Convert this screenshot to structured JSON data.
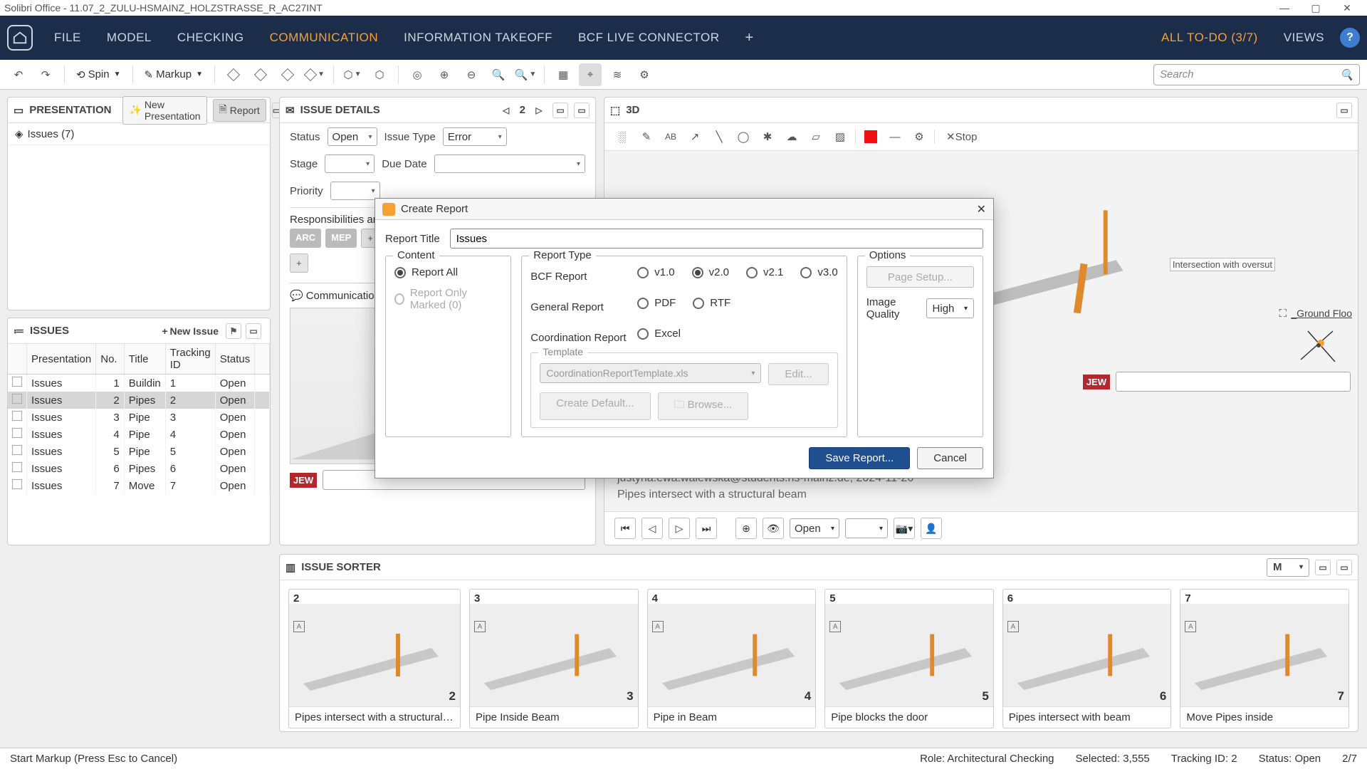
{
  "window": {
    "title": "Solibri Office - 11.07_2_ZULU-HSMAINZ_HOLZSTRASSE_R_AC27INT"
  },
  "nav": {
    "items": [
      "FILE",
      "MODEL",
      "CHECKING",
      "COMMUNICATION",
      "INFORMATION TAKEOFF",
      "BCF LIVE CONNECTOR"
    ],
    "todo": "ALL TO-DO (3/7)",
    "views": "VIEWS"
  },
  "toolbar": {
    "spin": "Spin",
    "markup": "Markup",
    "search_placeholder": "Search",
    "stop": "Stop"
  },
  "presentation": {
    "title": "PRESENTATION",
    "new": "New Presentation",
    "report": "Report",
    "row": "Issues (7)"
  },
  "issues_panel": {
    "title": "ISSUES",
    "new": "New Issue",
    "cols": [
      "",
      "Presentation",
      "No.",
      "Title",
      "Tracking ID",
      "Status",
      ""
    ],
    "rows": [
      {
        "p": "Issues",
        "n": "1",
        "t": "Buildin",
        "id": "1",
        "s": "Open"
      },
      {
        "p": "Issues",
        "n": "2",
        "t": "Pipes",
        "id": "2",
        "s": "Open"
      },
      {
        "p": "Issues",
        "n": "3",
        "t": "Pipe",
        "id": "3",
        "s": "Open"
      },
      {
        "p": "Issues",
        "n": "4",
        "t": "Pipe",
        "id": "4",
        "s": "Open"
      },
      {
        "p": "Issues",
        "n": "5",
        "t": "Pipe",
        "id": "5",
        "s": "Open"
      },
      {
        "p": "Issues",
        "n": "6",
        "t": "Pipes",
        "id": "6",
        "s": "Open"
      },
      {
        "p": "Issues",
        "n": "7",
        "t": "Move",
        "id": "7",
        "s": "Open"
      }
    ],
    "selected_index": 1
  },
  "details": {
    "title": "ISSUE DETAILS",
    "page": "2",
    "status_l": "Status",
    "status_v": "Open",
    "itype_l": "Issue Type",
    "itype_v": "Error",
    "stage_l": "Stage",
    "stage_v": "",
    "due_l": "Due Date",
    "due_v": "",
    "prio_l": "Priority",
    "prio_v": "",
    "resp_l": "Responsibilities an",
    "chips": [
      "ARC",
      "MEP"
    ],
    "comm_tab": "Communicatio",
    "badge": "JEW"
  },
  "view3d": {
    "title": "3D",
    "stop": "Stop",
    "gf": "_Ground Floo",
    "anno": "Intersection with oversut",
    "author_line": "justyna.ewa.walewska@students.hs-mainz.de, 2024-11-26",
    "desc_line": "Pipes intersect with a structural beam",
    "badge": "JEW",
    "status": "Open"
  },
  "sorter": {
    "title": "ISSUE SORTER",
    "size": "M",
    "cards": [
      {
        "n": "2",
        "cap": "Pipes intersect with a structural beam"
      },
      {
        "n": "3",
        "cap": "Pipe Inside Beam"
      },
      {
        "n": "4",
        "cap": "Pipe in Beam"
      },
      {
        "n": "5",
        "cap": "Pipe blocks the door"
      },
      {
        "n": "6",
        "cap": "Pipes intersect with beam"
      },
      {
        "n": "7",
        "cap": "Move Pipes inside"
      }
    ]
  },
  "statusbar": {
    "left": "Start Markup (Press Esc to Cancel)",
    "role": "Role: Architectural Checking",
    "selected": "Selected: 3,555",
    "tracking": "Tracking ID: 2",
    "status": "Status: Open",
    "page": "2/7"
  },
  "modal": {
    "title": "Create Report",
    "rt_label": "Report Title",
    "rt_value": "Issues",
    "content_legend": "Content",
    "report_all": "Report All",
    "report_marked": "Report Only Marked (0)",
    "type_legend": "Report Type",
    "bcf": "BCF Report",
    "bcf_opts": [
      "v1.0",
      "v2.0",
      "v2.1",
      "v3.0"
    ],
    "bcf_sel": "v2.0",
    "gen": "General Report",
    "gen_opts": [
      "PDF",
      "RTF"
    ],
    "coord": "Coordination Report",
    "coord_opts": [
      "Excel"
    ],
    "tmpl_legend": "Template",
    "tmpl_value": "CoordinationReportTemplate.xls",
    "edit": "Edit...",
    "create_default": "Create Default...",
    "browse": "Browse...",
    "opts_legend": "Options",
    "page_setup": "Page Setup...",
    "iq_label": "Image Quality",
    "iq_value": "High",
    "save": "Save Report...",
    "cancel": "Cancel"
  }
}
